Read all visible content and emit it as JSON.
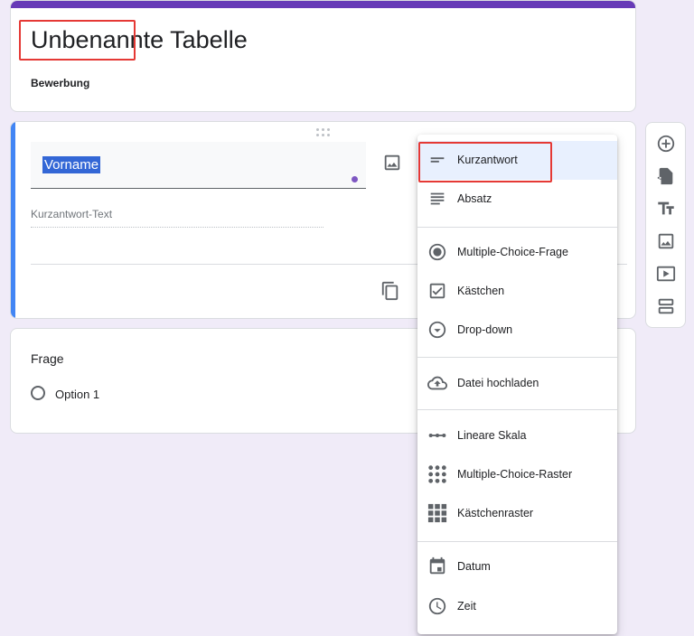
{
  "form": {
    "title": "Unbenannte Tabelle",
    "description": "Bewerbung"
  },
  "question": {
    "title_value": "Vorname",
    "answer_placeholder": "Kurzantwort-Text"
  },
  "second_question": {
    "title": "Frage",
    "option_label": "Option 1"
  },
  "menu": {
    "items": [
      {
        "label": "Kurzantwort",
        "icon": "short-text-icon",
        "selected": true
      },
      {
        "label": "Absatz",
        "icon": "paragraph-icon"
      },
      {
        "label": "Multiple-Choice-Frage",
        "icon": "radio-button-icon"
      },
      {
        "label": "Kästchen",
        "icon": "checkbox-icon"
      },
      {
        "label": "Drop-down",
        "icon": "dropdown-circle-icon"
      },
      {
        "label": "Datei hochladen",
        "icon": "cloud-upload-icon"
      },
      {
        "label": "Lineare Skala",
        "icon": "linear-scale-icon"
      },
      {
        "label": "Multiple-Choice-Raster",
        "icon": "dot-grid-icon"
      },
      {
        "label": "Kästchenraster",
        "icon": "checkbox-grid-icon"
      },
      {
        "label": "Datum",
        "icon": "calendar-icon"
      },
      {
        "label": "Zeit",
        "icon": "clock-icon"
      }
    ]
  },
  "toolbar": {
    "icons": [
      "add-question-icon",
      "import-questions-icon",
      "add-title-icon",
      "add-image-icon",
      "add-video-icon",
      "add-section-icon"
    ]
  },
  "colors": {
    "accent": "#673ab7",
    "active_question": "#4285f4",
    "background": "#f0ebf8",
    "highlight_box": "#e53935",
    "selection": "#3367d6"
  }
}
